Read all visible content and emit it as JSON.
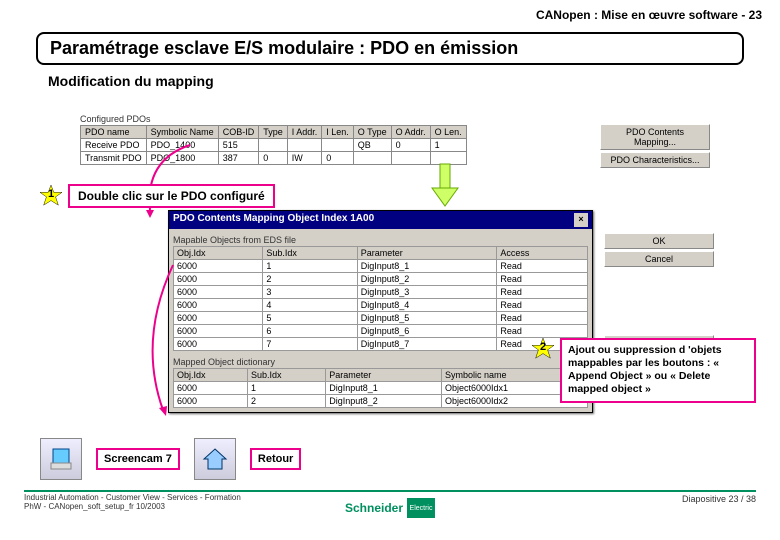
{
  "page_header": "CANopen : Mise en œuvre software - 23",
  "title": "Paramétrage esclave E/S modulaire : PDO en émission",
  "subtitle": "Modification du mapping",
  "configured_pdos": {
    "group_label": "Configured PDOs",
    "headers": [
      "PDO name",
      "Symbolic Name",
      "COB-ID",
      "Type",
      "I Addr.",
      "I Len.",
      "O Type",
      "O Addr.",
      "O Len."
    ],
    "rows": [
      [
        "Receive PDO",
        "PDO_1400",
        "515",
        "",
        "",
        "",
        "QB",
        "0",
        "1"
      ],
      [
        "Transmit PDO",
        "PDO_1800",
        "387",
        "0",
        "IW",
        "0",
        "",
        "",
        ""
      ]
    ]
  },
  "right_buttons": [
    "PDO Contents Mapping...",
    "PDO Characteristics..."
  ],
  "step1": {
    "num": "1",
    "text": "Double clic sur le PDO configuré"
  },
  "dialog": {
    "title": "PDO Contents Mapping Object Index 1A00",
    "group1_label": "Mapable Objects from EDS file",
    "group1_headers": [
      "Obj.Idx",
      "Sub.Idx",
      "Parameter",
      "Access"
    ],
    "group1_rows": [
      [
        "6000",
        "1",
        "DigInput8_1",
        "Read"
      ],
      [
        "6000",
        "2",
        "DigInput8_2",
        "Read"
      ],
      [
        "6000",
        "3",
        "DigInput8_3",
        "Read"
      ],
      [
        "6000",
        "4",
        "DigInput8_4",
        "Read"
      ],
      [
        "6000",
        "5",
        "DigInput8_5",
        "Read"
      ],
      [
        "6000",
        "6",
        "DigInput8_6",
        "Read"
      ],
      [
        "6000",
        "7",
        "DigInput8_7",
        "Read"
      ]
    ],
    "group2_label": "Mapped Object dictionary",
    "group2_headers": [
      "Obj.Idx",
      "Sub.Idx",
      "Parameter",
      "Symbolic name"
    ],
    "group2_rows": [
      [
        "6000",
        "1",
        "DigInput8_1",
        "Object6000Idx1"
      ],
      [
        "6000",
        "2",
        "DigInput8_2",
        "Object6000Idx2"
      ]
    ],
    "ok": "OK",
    "cancel": "Cancel",
    "append": "Append Object",
    "delete": "Delete mapped Object"
  },
  "step2": {
    "num": "2",
    "text": "Ajout ou suppression d 'objets mappables par les boutons : « Append Object » ou « Delete mapped object »"
  },
  "footer": {
    "screencam": "Screencam 7",
    "retour": "Retour",
    "bot_line1": "Industrial Automation - Customer View - Services - Formation",
    "bot_line2": "PhW - CANopen_soft_setup_fr   10/2003",
    "logo_text": "Schneider",
    "logo_sub": "Electric",
    "slide": "Diapositive 23 / 38"
  }
}
